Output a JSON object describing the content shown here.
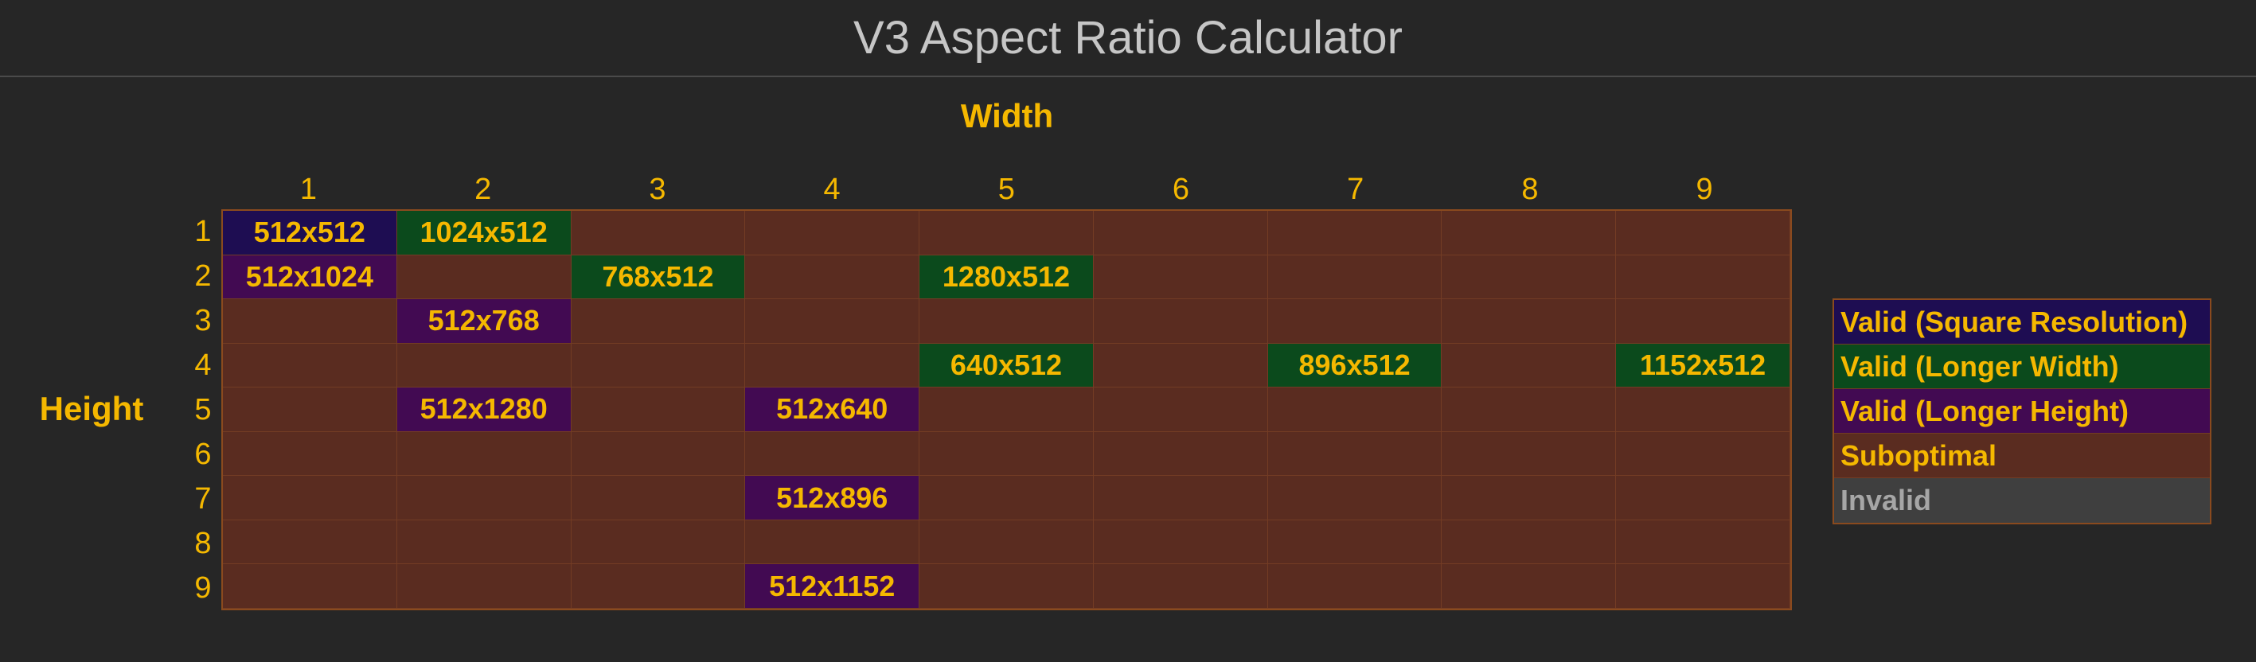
{
  "title": "V3 Aspect Ratio Calculator",
  "width_label": "Width",
  "height_label": "Height",
  "columns": [
    "1",
    "2",
    "3",
    "4",
    "5",
    "6",
    "7",
    "8",
    "9"
  ],
  "rows": [
    "1",
    "2",
    "3",
    "4",
    "5",
    "6",
    "7",
    "8",
    "9"
  ],
  "colors": {
    "square": "#1e0d52",
    "longer_width": "#0b4a1c",
    "longer_height": "#420a52",
    "suboptimal": "#5a2c20",
    "invalid": "#3f3f3f",
    "label_text": "#f5b800"
  },
  "cells": [
    [
      "512x512",
      "1024x512",
      "",
      "",
      "",
      "",
      "",
      "",
      ""
    ],
    [
      "512x1024",
      "",
      "768x512",
      "",
      "1280x512",
      "",
      "",
      "",
      ""
    ],
    [
      "",
      "512x768",
      "",
      "",
      "",
      "",
      "",
      "",
      ""
    ],
    [
      "",
      "",
      "",
      "",
      "640x512",
      "",
      "896x512",
      "",
      "1152x512"
    ],
    [
      "",
      "512x1280",
      "",
      "512x640",
      "",
      "",
      "",
      "",
      ""
    ],
    [
      "",
      "",
      "",
      "",
      "",
      "",
      "",
      "",
      ""
    ],
    [
      "",
      "",
      "",
      "512x896",
      "",
      "",
      "",
      "",
      ""
    ],
    [
      "",
      "",
      "",
      "",
      "",
      "",
      "",
      "",
      ""
    ],
    [
      "",
      "",
      "",
      "512x1152",
      "",
      "",
      "",
      "",
      ""
    ]
  ],
  "cell_types": [
    [
      "square",
      "width",
      "suboptimal",
      "suboptimal",
      "suboptimal",
      "suboptimal",
      "suboptimal",
      "suboptimal",
      "suboptimal"
    ],
    [
      "height",
      "suboptimal",
      "width",
      "suboptimal",
      "width",
      "suboptimal",
      "suboptimal",
      "suboptimal",
      "suboptimal"
    ],
    [
      "suboptimal",
      "height",
      "suboptimal",
      "suboptimal",
      "suboptimal",
      "suboptimal",
      "suboptimal",
      "suboptimal",
      "suboptimal"
    ],
    [
      "suboptimal",
      "suboptimal",
      "suboptimal",
      "suboptimal",
      "width",
      "suboptimal",
      "width",
      "suboptimal",
      "width"
    ],
    [
      "suboptimal",
      "height",
      "suboptimal",
      "height",
      "suboptimal",
      "suboptimal",
      "suboptimal",
      "suboptimal",
      "suboptimal"
    ],
    [
      "suboptimal",
      "suboptimal",
      "suboptimal",
      "suboptimal",
      "suboptimal",
      "suboptimal",
      "suboptimal",
      "suboptimal",
      "suboptimal"
    ],
    [
      "suboptimal",
      "suboptimal",
      "suboptimal",
      "height",
      "suboptimal",
      "suboptimal",
      "suboptimal",
      "suboptimal",
      "suboptimal"
    ],
    [
      "suboptimal",
      "suboptimal",
      "suboptimal",
      "suboptimal",
      "suboptimal",
      "suboptimal",
      "suboptimal",
      "suboptimal",
      "suboptimal"
    ],
    [
      "suboptimal",
      "suboptimal",
      "suboptimal",
      "height",
      "suboptimal",
      "suboptimal",
      "suboptimal",
      "suboptimal",
      "suboptimal"
    ]
  ],
  "legend": [
    {
      "type": "square",
      "label": "Valid (Square Resolution)"
    },
    {
      "type": "width",
      "label": "Valid (Longer Width)"
    },
    {
      "type": "height",
      "label": "Valid (Longer Height)"
    },
    {
      "type": "suboptimal",
      "label": "Suboptimal"
    },
    {
      "type": "invalid",
      "label": "Invalid"
    }
  ]
}
